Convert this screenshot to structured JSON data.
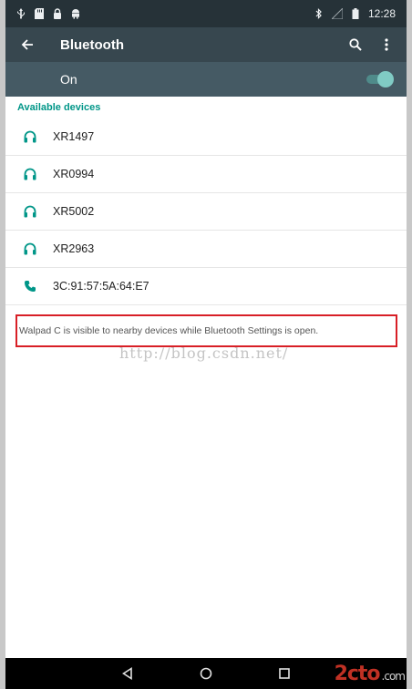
{
  "statusbar": {
    "time": "12:28"
  },
  "appbar": {
    "title": "Bluetooth"
  },
  "switchbar": {
    "label": "On",
    "state": "on"
  },
  "section": {
    "available_label": "Available devices"
  },
  "devices": [
    {
      "name": "XR1497",
      "icon": "headphones-icon"
    },
    {
      "name": "XR0994",
      "icon": "headphones-icon"
    },
    {
      "name": "XR5002",
      "icon": "headphones-icon"
    },
    {
      "name": "XR2963",
      "icon": "headphones-icon"
    },
    {
      "name": "3C:91:57:5A:64:E7",
      "icon": "phone-icon"
    }
  ],
  "visibility_note": "Walpad C is visible to nearby devices while Bluetooth Settings is open.",
  "watermark": "http://blog.csdn.net/",
  "corner_logo": {
    "text": "2cto",
    "tail": ".com"
  },
  "colors": {
    "accent": "#009688",
    "appbar": "#37474f",
    "statusbar": "#263238",
    "switchbar": "#455a64",
    "highlight_box": "#d81f26"
  }
}
